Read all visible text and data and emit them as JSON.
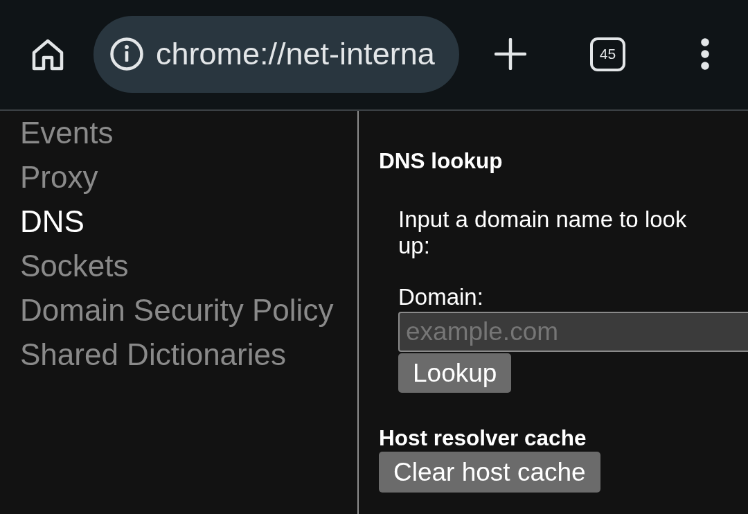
{
  "toolbar": {
    "url": "chrome://net-interna",
    "tab_count": "45"
  },
  "sidebar": {
    "items": [
      {
        "label": "Events",
        "selected": false
      },
      {
        "label": "Proxy",
        "selected": false
      },
      {
        "label": "DNS",
        "selected": true
      },
      {
        "label": "Sockets",
        "selected": false
      },
      {
        "label": "Domain Security Policy",
        "selected": false
      },
      {
        "label": "Shared Dictionaries",
        "selected": false
      }
    ]
  },
  "dns_lookup": {
    "title": "DNS lookup",
    "instructions": "Input a domain name to look up:",
    "domain_label": "Domain:",
    "domain_field": {
      "placeholder": "example.com"
    },
    "button": "Lookup"
  },
  "host_resolver_cache": {
    "title": "Host resolver cache",
    "button": "Clear host cache"
  }
}
